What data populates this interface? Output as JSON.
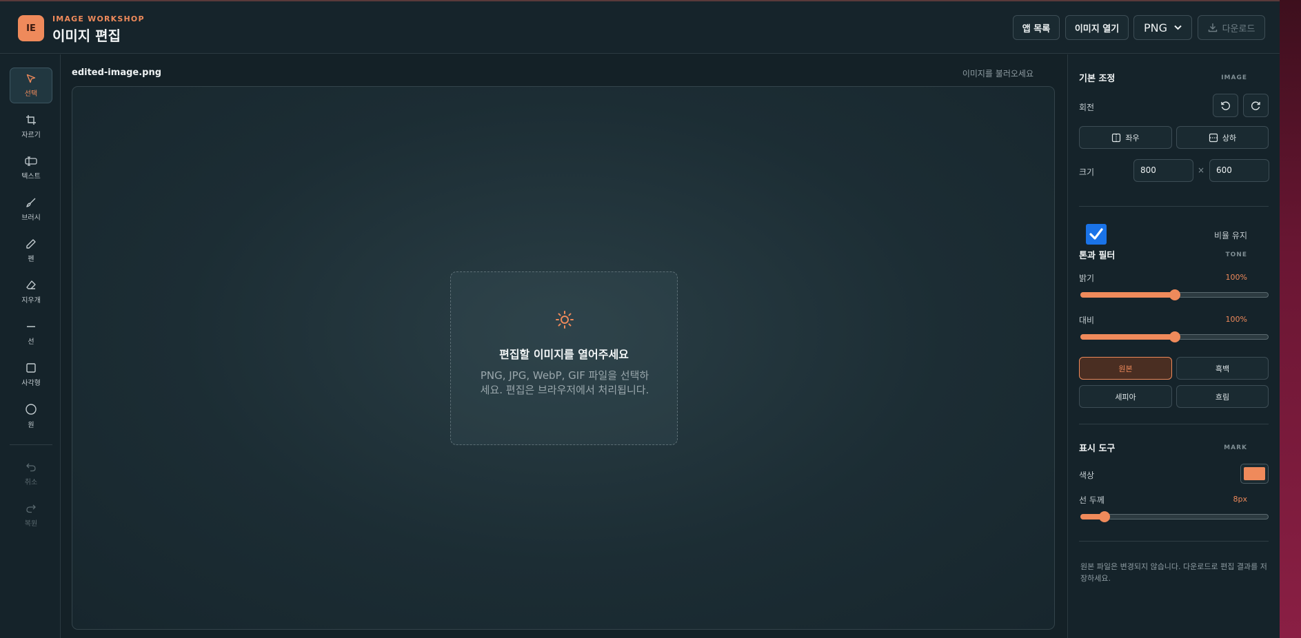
{
  "header": {
    "logo_text": "IE",
    "brand_sub": "IMAGE WORKSHOP",
    "title": "이미지 편집",
    "apps_button": "앱 목록",
    "open_button": "이미지 열기",
    "format_value": "PNG",
    "download_button": "다운로드"
  },
  "tools": [
    {
      "label": "선택",
      "icon": "cursor-icon"
    },
    {
      "label": "자르기",
      "icon": "crop-icon"
    },
    {
      "label": "텍스트",
      "icon": "text-icon"
    },
    {
      "label": "브러시",
      "icon": "brush-icon"
    },
    {
      "label": "펜",
      "icon": "pen-icon"
    },
    {
      "label": "지우개",
      "icon": "eraser-icon"
    },
    {
      "label": "선",
      "icon": "line-icon"
    },
    {
      "label": "사각형",
      "icon": "rectangle-icon"
    },
    {
      "label": "원",
      "icon": "circle-icon"
    },
    {
      "label": "취소",
      "icon": "undo-icon"
    },
    {
      "label": "복원",
      "icon": "redo-icon"
    }
  ],
  "canvas": {
    "file_name": "edited-image.png",
    "hint": "이미지를 불러오세요",
    "drop_title": "편집할 이미지를 열어주세요",
    "drop_desc": "PNG, JPG, WebP, GIF 파일을 선택하세요. 편집은 브라우저에서 처리됩니다."
  },
  "panel": {
    "basic": {
      "title": "기본 조정",
      "tag": "IMAGE",
      "rotate_label": "회전",
      "flip_h": "좌우",
      "flip_v": "상하",
      "size_label": "크기",
      "width": "800",
      "times": "×",
      "height": "600",
      "ratio_label": "비율 유지",
      "ratio_checked": true
    },
    "tone": {
      "title": "톤과 필터",
      "tag": "TONE",
      "brightness_label": "밝기",
      "brightness_value": "100%",
      "brightness_fraction": 0.5,
      "contrast_label": "대비",
      "contrast_value": "100%",
      "contrast_fraction": 0.5,
      "filters": [
        "원본",
        "흑백",
        "세피아",
        "흐림"
      ],
      "active_filter": "원본"
    },
    "mark": {
      "title": "표시 도구",
      "tag": "MARK",
      "color_label": "색상",
      "color": "#ef8a5b",
      "stroke_label": "선 두께",
      "stroke_value": "8px",
      "stroke_fraction": 0.13
    },
    "note": "원본 파일은 변경되지 않습니다. 다운로드로 편집 결과를 저장하세요."
  },
  "colors": {
    "accent": "#ef8a5b",
    "background": "#142127",
    "check": "#1a73e8"
  }
}
